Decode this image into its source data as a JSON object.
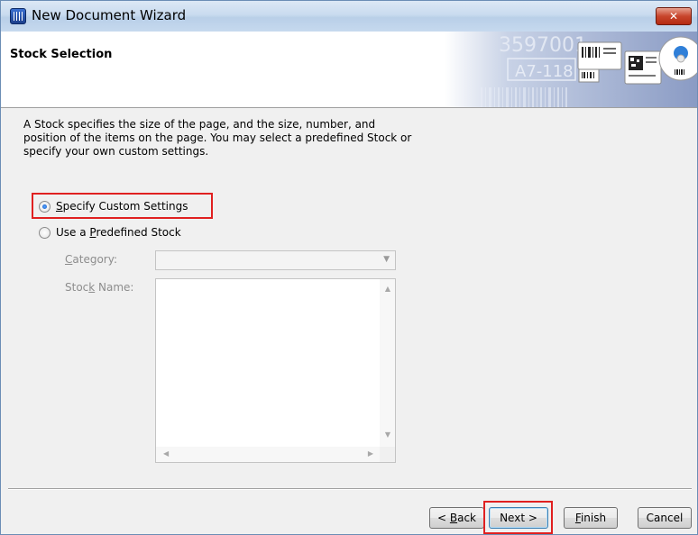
{
  "window": {
    "title": "New Document Wizard",
    "close_icon": "close-icon"
  },
  "header": {
    "title": "Stock Selection",
    "banner_texts": [
      "3597001",
      "A7-118"
    ]
  },
  "main": {
    "description": "A Stock specifies the size of the page, and the size, number, and position of the items on the page. You may select a predefined Stock or specify your own custom settings.",
    "options": [
      {
        "label": "Specify Custom Settings",
        "mnemonic": "S",
        "rest": "pecify Custom Settings",
        "checked": true
      },
      {
        "label": "Use a Predefined Stock",
        "pre": "Use a ",
        "mnemonic": "P",
        "rest": "redefined Stock",
        "checked": false
      }
    ],
    "category": {
      "label": "Category:",
      "mnemonic": "C",
      "rest": "ategory:",
      "value": ""
    },
    "stock_name": {
      "label": "Stock Name:",
      "pre": "Stoc",
      "mnemonic": "k",
      "rest": " Name:",
      "items": []
    }
  },
  "buttons": {
    "back": {
      "label": "< Back",
      "pre": "< ",
      "mnemonic": "B",
      "rest": "ack"
    },
    "next": {
      "label": "Next >"
    },
    "finish": {
      "label": "Finish",
      "mnemonic": "F",
      "rest": "inish"
    },
    "cancel": {
      "label": "Cancel"
    }
  },
  "colors": {
    "highlight": "#e02020",
    "title_bar": "#c9dbef"
  }
}
